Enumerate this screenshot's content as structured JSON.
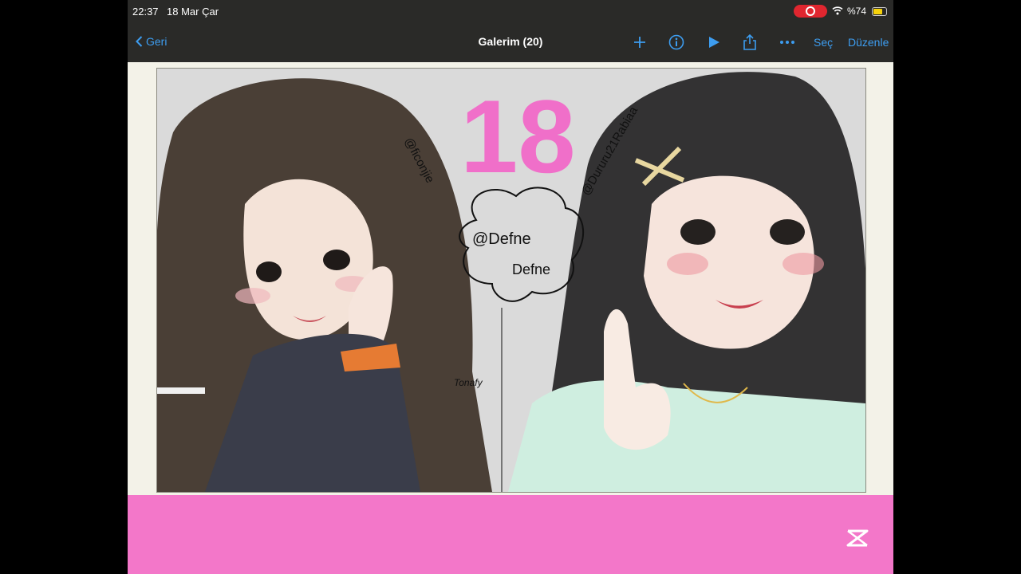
{
  "status": {
    "time": "22:37",
    "date": "18 Mar Çar",
    "battery": "%74"
  },
  "nav": {
    "back_label": "Geri",
    "title": "Galerim (20)",
    "select_label": "Seç",
    "edit_label": "Düzenle"
  },
  "artwork": {
    "big_text": "18",
    "left_signature": "@ficonjie",
    "right_signature": "@Dururu21Rabiaa",
    "bubble_line1": "@Defne",
    "bubble_line2": "Defne",
    "small_signature": "Tonafy"
  },
  "colors": {
    "accent": "#3d9df0",
    "record": "#e0262f",
    "pink": "#f377c9",
    "battery": "#f5d20b"
  },
  "icons": [
    "chevron-left-icon",
    "plus-icon",
    "info-icon",
    "play-icon",
    "share-icon",
    "more-icon",
    "capcut-logo-icon",
    "wifi-icon",
    "record-icon",
    "battery-icon"
  ]
}
